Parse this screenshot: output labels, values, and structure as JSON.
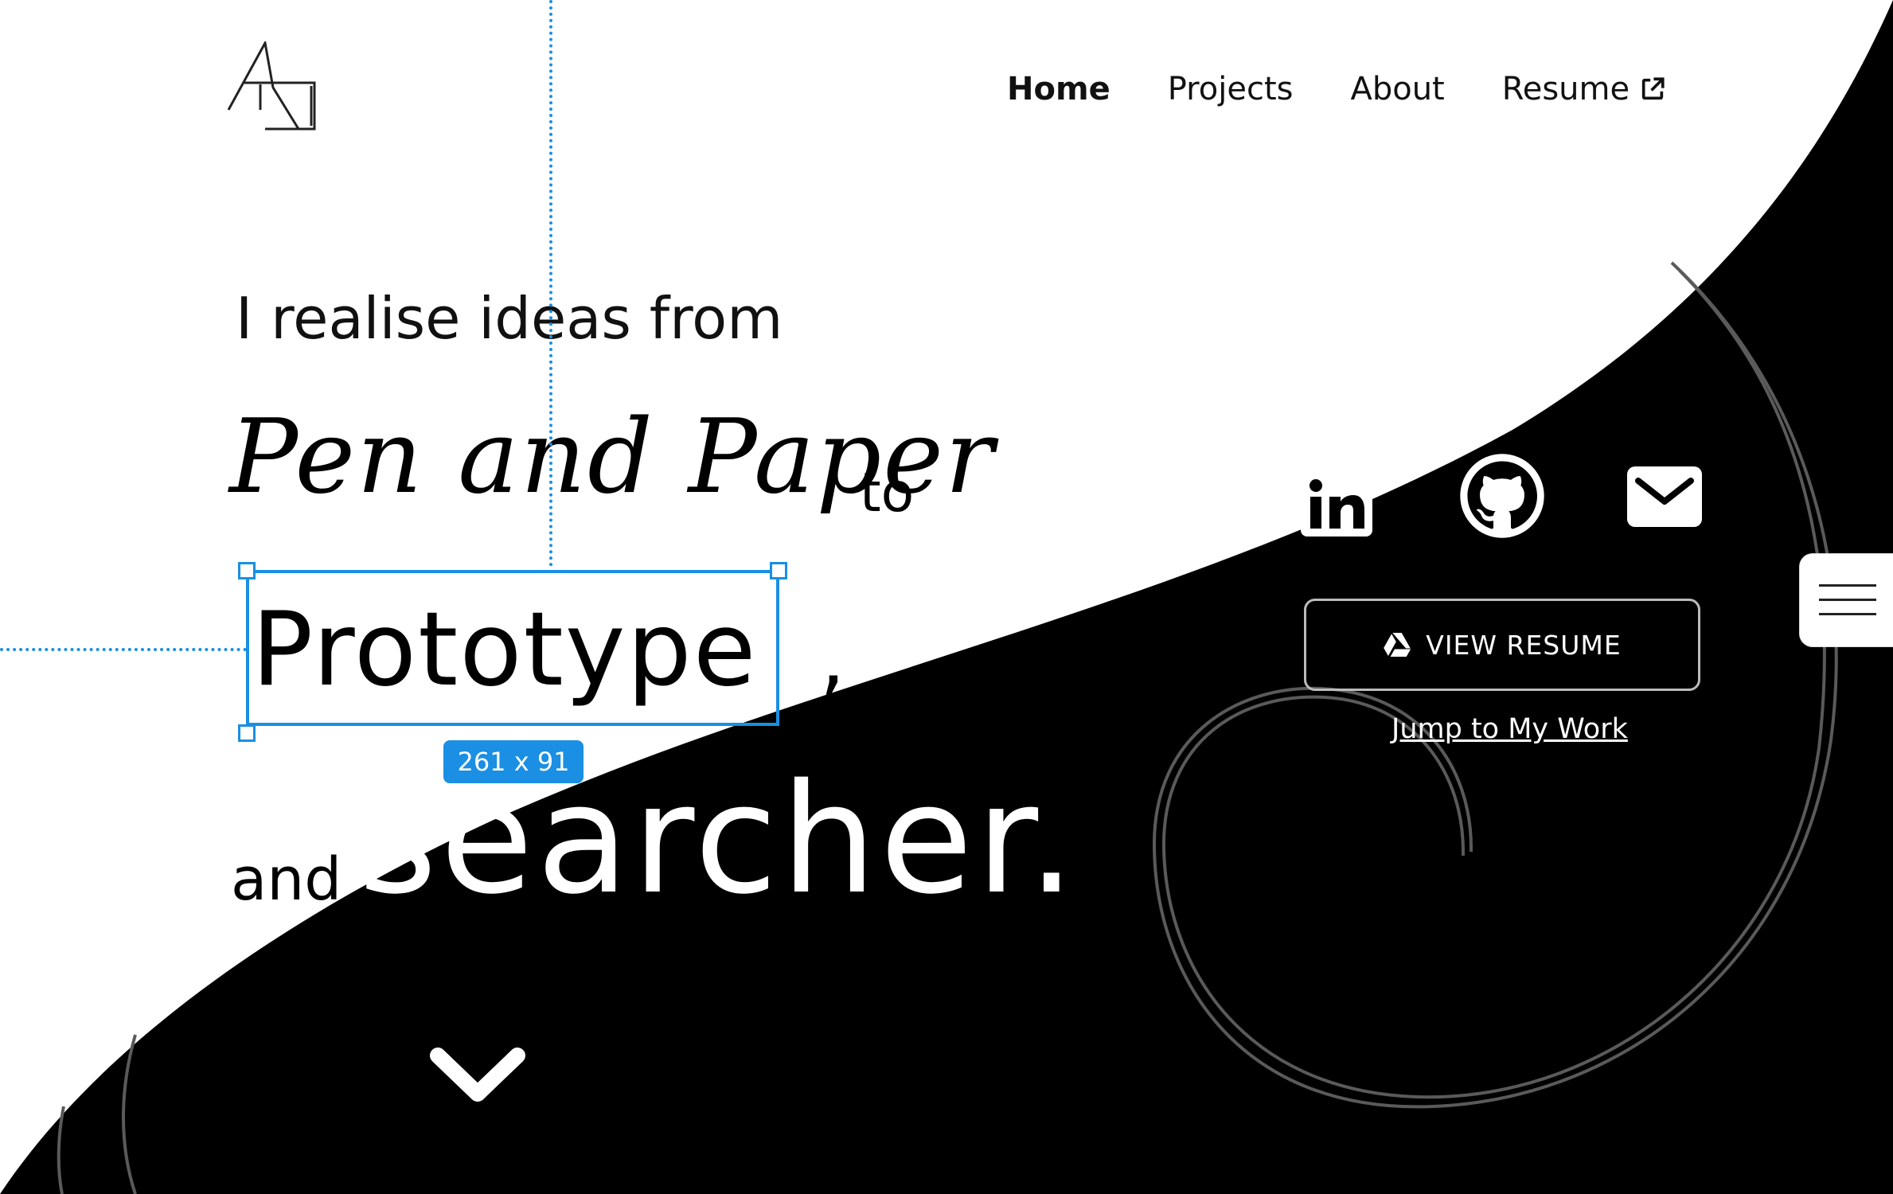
{
  "nav": {
    "items": [
      {
        "label": "Home",
        "active": true
      },
      {
        "label": "Projects",
        "active": false
      },
      {
        "label": "About",
        "active": false
      },
      {
        "label": "Resume",
        "active": false,
        "icon": "external-link-icon"
      }
    ]
  },
  "hero": {
    "intro": "I realise ideas from",
    "handwritten": "Pen and Paper",
    "to": "to",
    "prototype": "Prototype",
    "prototype_tail": ",",
    "and": "and",
    "researcher": "searcher."
  },
  "selection": {
    "size_label": "261 x 91"
  },
  "social": {
    "icons": [
      "linkedin-icon",
      "github-icon",
      "mail-icon"
    ]
  },
  "resume_button": {
    "label": "VIEW RESUME",
    "icon": "google-drive-icon"
  },
  "jump_link": "Jump to My Work",
  "colors": {
    "background": "#ffffff",
    "swoosh": "#000000",
    "selection": "#1a8fe3",
    "text": "#111111"
  },
  "icons": {
    "scroll_down": "chevron-down-icon",
    "menu": "hamburger-icon",
    "logo": "logo-icon"
  }
}
